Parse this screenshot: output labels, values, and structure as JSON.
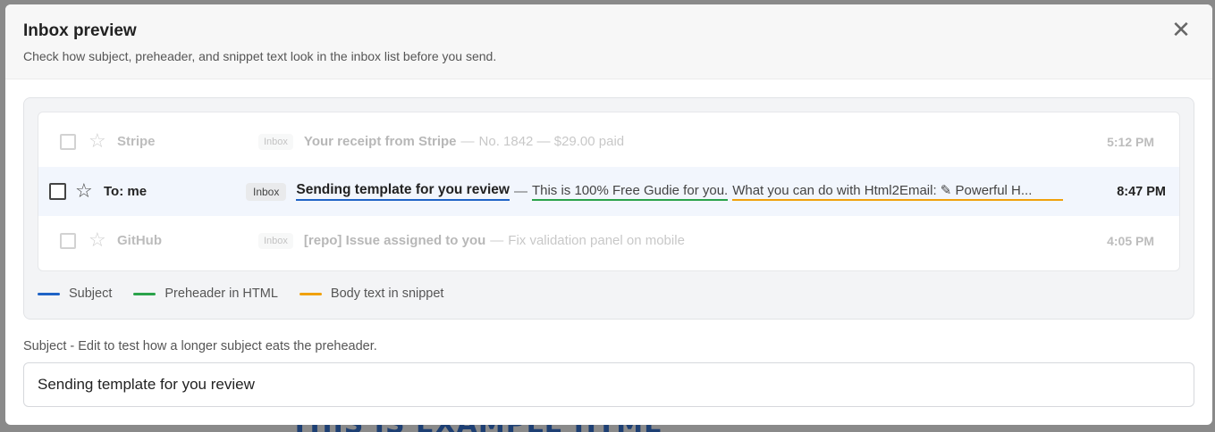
{
  "backdrop": {
    "text": "THIS IS EXAMPLE HTML"
  },
  "modal": {
    "title": "Inbox preview",
    "subtitle": "Check how subject, preheader, and snippet text look in the inbox list before you send.",
    "close_label": "✕"
  },
  "inbox": {
    "rows": [
      {
        "sender": "Stripe",
        "label": "Inbox",
        "subject": "Your receipt from Stripe",
        "separator": "—",
        "rest": "No. 1842 — $29.00 paid",
        "time": "5:12 PM",
        "state": "faded"
      },
      {
        "sender": "To: me",
        "label": "Inbox",
        "subject": "Sending template for you review",
        "separator": "—",
        "preheader": "This is 100% Free Gudie for you.",
        "snippet": "What you can do with Html2Email: ✎ Powerful H...",
        "time": "8:47 PM",
        "state": "active"
      },
      {
        "sender": "GitHub",
        "label": "Inbox",
        "subject": "[repo] Issue assigned to you",
        "separator": "—",
        "rest": "Fix validation panel on mobile",
        "time": "4:05 PM",
        "state": "faded"
      }
    ],
    "checkbox_icon": "checkbox-empty-icon",
    "star_glyph": "☆"
  },
  "legend": {
    "items": [
      {
        "label": "Subject",
        "color": "#1f63c6"
      },
      {
        "label": "Preheader in HTML",
        "color": "#2aa24a"
      },
      {
        "label": "Body text in snippet",
        "color": "#f0a10c"
      }
    ]
  },
  "subject_field": {
    "label": "Subject - Edit to test how a longer subject eats the preheader.",
    "value": "Sending template for you review"
  }
}
